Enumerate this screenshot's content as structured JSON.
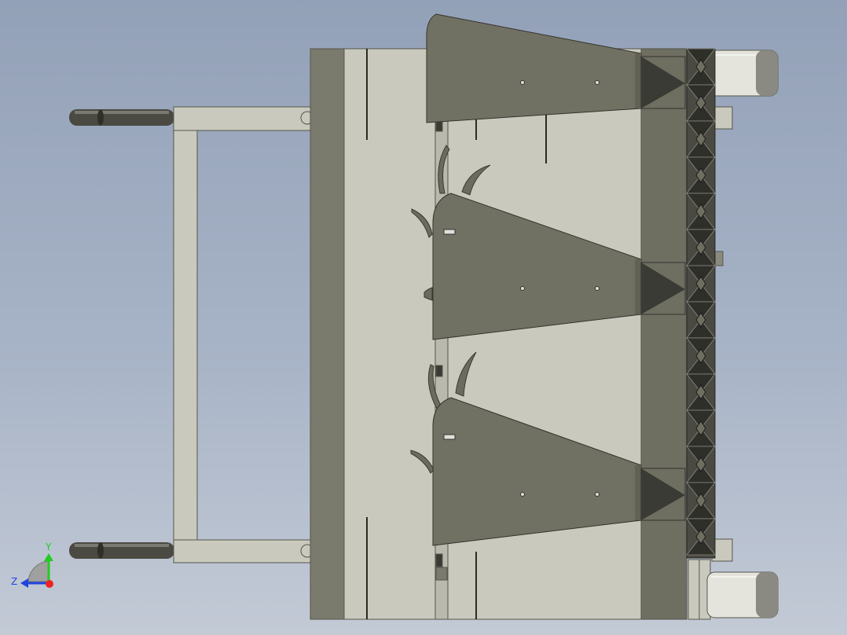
{
  "viewport": {
    "background_top": "#93a1b8",
    "background_bottom": "#c3cad6"
  },
  "model": {
    "frame_color": "#c9c9bd",
    "dark_panel_color": "#7b7b6d",
    "hopper_color": "#717163",
    "tooth_color": "#3b3b35",
    "wheel_color": "#e4e4dc",
    "handle_color": "#4a4a42"
  },
  "triad": {
    "y_label": "Y",
    "z_label": "Z",
    "y_color": "#22cc22",
    "z_color": "#2244dd",
    "x_color": "#ee2222"
  }
}
